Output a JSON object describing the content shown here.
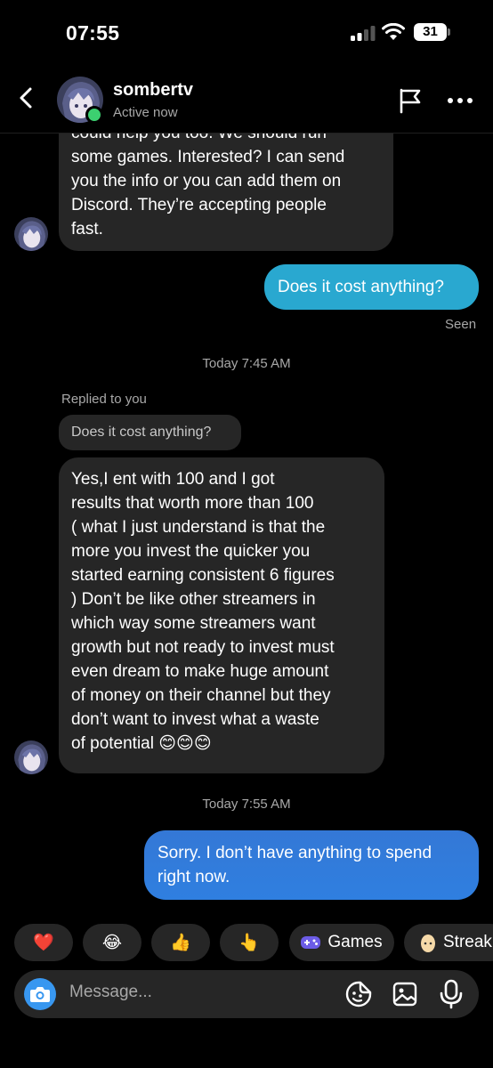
{
  "status_bar": {
    "time": "07:55",
    "battery": "31"
  },
  "header": {
    "username": "sombertv",
    "status": "Active now",
    "icons": [
      "back-icon",
      "flag-icon",
      "more-icon"
    ]
  },
  "messages": {
    "m1_lines": [
      "could help you too. We should run",
      "some games. Interested? I can send",
      "you the info or you can add them on",
      "Discord. They’re accepting people",
      "fast."
    ],
    "m2": "Does it cost anything?",
    "seen": "Seen",
    "time1": "Today 7:45 AM",
    "replied_label": "Replied to you",
    "quoted": "Does it cost anything?",
    "m3_lines": [
      "Yes,I ent with 100 and I got",
      "results that worth more than 100",
      "( what I just understand is that the",
      "more you invest the quicker you",
      "started earning consistent 6 figures",
      ") Don’t be like other streamers in",
      "which way some streamers want",
      "growth but not ready to invest must",
      "even dream to make huge amount",
      "of money on their channel but they",
      "don’t want to invest what a waste",
      "of potential 😊😊😊"
    ],
    "time2": "Today 7:55 AM",
    "m4_lines": [
      "Sorry. I don’t have anything to spend",
      "right now."
    ]
  },
  "quick_reactions": {
    "heart": "❤️",
    "laugh": "😂",
    "thumbs": "👍",
    "point": "👆",
    "games_label": "Games",
    "streak_label": "Streak"
  },
  "composer": {
    "placeholder": "Message..."
  },
  "colors": {
    "incoming_bubble": "#262626",
    "outgoing_light": "#29a8d0",
    "outgoing_gradient": [
      "#3478d6",
      "#2f7fe0"
    ],
    "online": "#3cd070",
    "camera": "#3897f0"
  }
}
